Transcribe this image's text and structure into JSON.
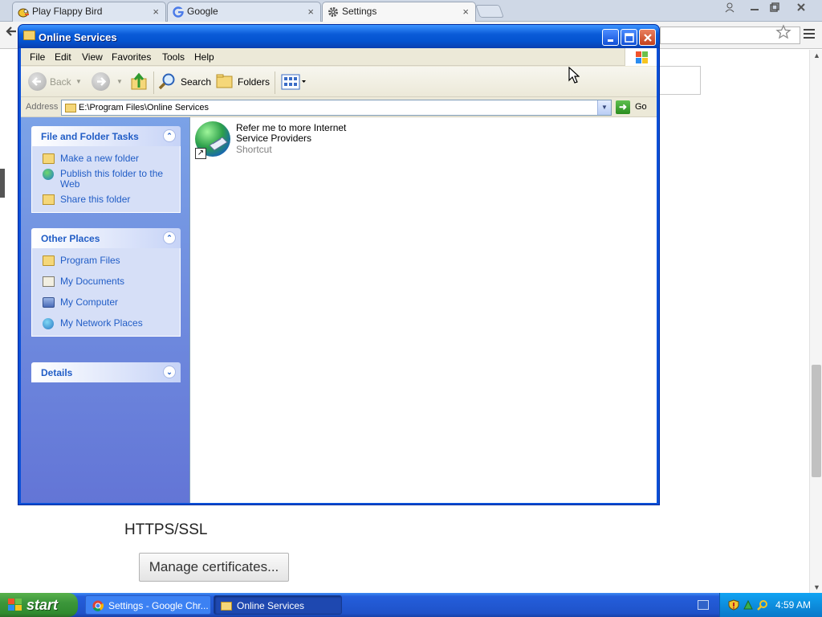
{
  "browser": {
    "tabs": [
      {
        "label": "Play Flappy Bird",
        "icon": "flappy-bird-icon",
        "active": false
      },
      {
        "label": "Google",
        "icon": "google-icon",
        "active": false
      },
      {
        "label": "Settings",
        "icon": "gear-icon",
        "active": true
      }
    ],
    "close_glyph": "×",
    "settings_section": {
      "heading": "HTTPS/SSL",
      "manage_button": "Manage certificates..."
    }
  },
  "explorer": {
    "title": "Online Services",
    "window_buttons": {
      "minimize": "_",
      "maximize": "□",
      "close": "✕"
    },
    "menu": [
      "File",
      "Edit",
      "View",
      "Favorites",
      "Tools",
      "Help"
    ],
    "toolbar": {
      "back": "Back",
      "search": "Search",
      "folders": "Folders"
    },
    "address": {
      "label": "Address",
      "value": "E:\\Program Files\\Online Services",
      "go": "Go"
    },
    "task_pane": {
      "file_tasks": {
        "title": "File and Folder Tasks",
        "links": [
          {
            "label": "Make a new folder",
            "icon": "new-folder-icon"
          },
          {
            "label": "Publish this folder to the Web",
            "icon": "globe-icon"
          },
          {
            "label": "Share this folder",
            "icon": "share-folder-icon"
          }
        ]
      },
      "other_places": {
        "title": "Other Places",
        "links": [
          {
            "label": "Program Files",
            "icon": "folder-icon"
          },
          {
            "label": "My Documents",
            "icon": "documents-icon"
          },
          {
            "label": "My Computer",
            "icon": "computer-icon"
          },
          {
            "label": "My Network Places",
            "icon": "network-icon"
          }
        ]
      },
      "details": {
        "title": "Details"
      }
    },
    "files": [
      {
        "name": "Refer me to more Internet Service Providers",
        "type": "Shortcut",
        "icon": "internet-globe-shortcut-icon"
      }
    ]
  },
  "taskbar": {
    "start": "start",
    "tasks": [
      {
        "label": "Settings - Google Chr...",
        "icon": "chrome-icon"
      },
      {
        "label": "Online Services",
        "icon": "folder-icon",
        "active": true
      }
    ],
    "clock": "4:59 AM"
  }
}
